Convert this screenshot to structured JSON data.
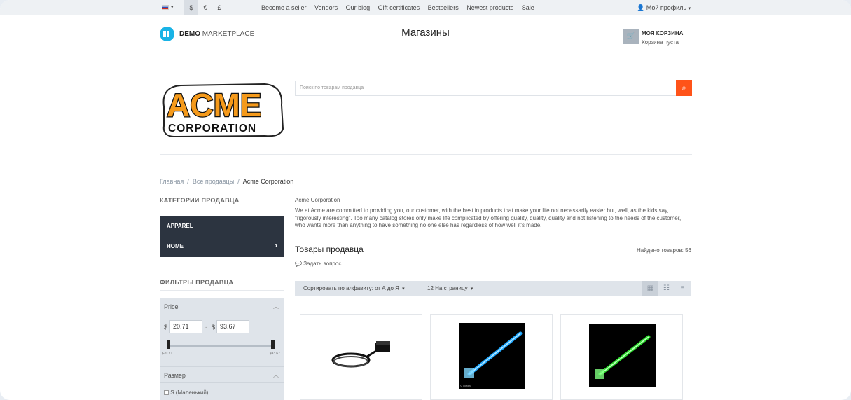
{
  "topbar": {
    "currencies": [
      "$",
      "€",
      "£"
    ],
    "links": [
      "Become a seller",
      "Vendors",
      "Our blog",
      "Gift certificates",
      "Bestsellers",
      "Newest products",
      "Sale"
    ],
    "profile_label": "Мой профиль"
  },
  "header": {
    "brand_bold": "DEMO",
    "brand_rest": " MARKETPLACE",
    "page_title": "Магазины",
    "cart_title": "МОЯ КОРЗИНА",
    "cart_status": "Корзина пуста"
  },
  "vendor_logo": {
    "line1": "ACME",
    "line2": "CORPORATION"
  },
  "search": {
    "placeholder": "Поиск по товарам продавца"
  },
  "breadcrumbs": [
    "Главная",
    "Все продавцы",
    "Acme Corporation"
  ],
  "sidebar": {
    "categories_title": "КАТЕГОРИИ ПРОДАВЦА",
    "categories": [
      "APPAREL",
      "HOME"
    ],
    "filters_title": "ФИЛЬТРЫ ПРОДАВЦА",
    "price": {
      "title": "Price",
      "currency": "$",
      "min": "20.71",
      "max": "93.67",
      "min_label": "$20.71",
      "max_label": "$93.67"
    },
    "size": {
      "title": "Размер",
      "option": "S (Маленький)"
    }
  },
  "main": {
    "vendor_name": "Acme Corporation",
    "description": "We at Acme are committed to providing you, our customer, with the best in products that make your life not necessarily easier but, well, as the kids say, \"rigorously interesting\". Too many catalog stores only make life complicated by offering quality, quality, quality and not listening to the needs of the customer, who wants more than anything to have something no one else has regardless of how well it's made.",
    "products_title": "Товары продавца",
    "found": "Найдено товаров: 56",
    "ask": "Задать вопрос",
    "sort": "Сортировать по алфавиту: от А до Я",
    "per_page": "12 На страницу",
    "products": [
      {
        "caption": ""
      },
      {
        "caption": "© dkasa"
      },
      {
        "caption": ""
      }
    ]
  },
  "colors": {
    "accent": "#ff5319",
    "dark": "#2c3440",
    "logo": "#19b3e6",
    "acme_orange": "#f59a1b"
  }
}
